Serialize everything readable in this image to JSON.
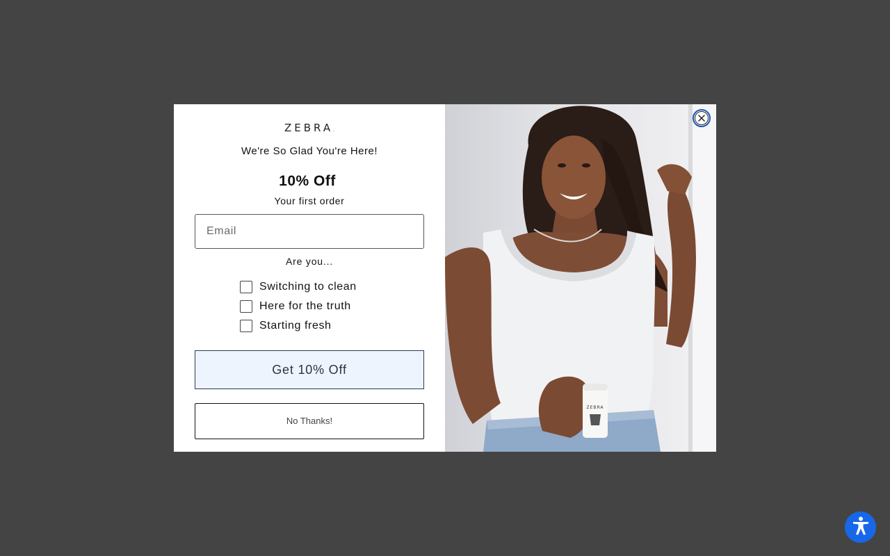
{
  "popup": {
    "logo_text": "ZEBRA",
    "logo_mark": ".",
    "greeting": "We're So Glad You're Here!",
    "offer_title": "10% Off",
    "offer_subtitle": "Your first order",
    "email_placeholder": "Email",
    "email_value": "",
    "question": "Are you...",
    "options": [
      {
        "label": "Switching to clean",
        "checked": false
      },
      {
        "label": "Here for the truth",
        "checked": false
      },
      {
        "label": "Starting fresh",
        "checked": false
      }
    ],
    "primary_button": "Get 10% Off",
    "secondary_button": "No Thanks!",
    "close_icon": "close-icon",
    "image": "woman-holding-deodorant-photo",
    "product_label": "ZEBRA"
  },
  "accessibility": {
    "icon": "accessibility-icon"
  },
  "colors": {
    "overlay": "#444444",
    "primary_button_bg": "#eef4fe",
    "close_ring": "#1e56b8",
    "accessibility_button": "#1867e8"
  }
}
